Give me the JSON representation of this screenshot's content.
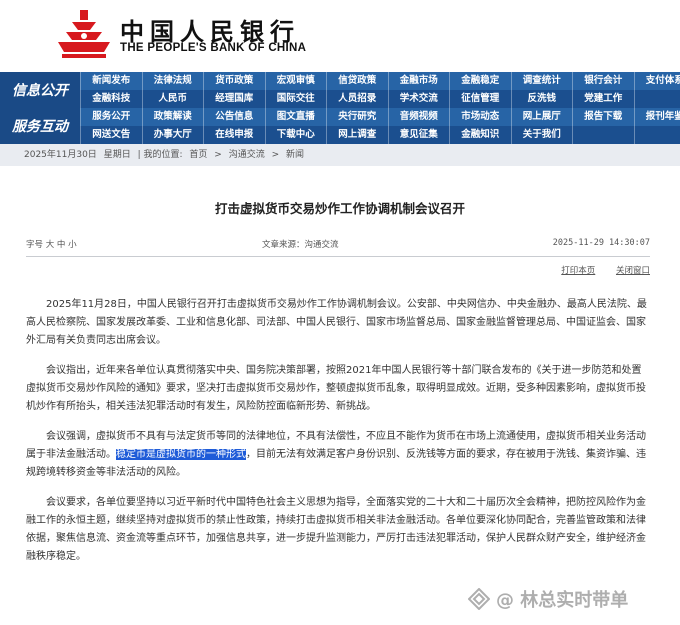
{
  "header": {
    "cn_name": "中国人民银行",
    "en_name": "THE PEOPLE'S BANK OF CHINA"
  },
  "nav": {
    "section1": "信息公开",
    "section2": "服务互动",
    "row1": [
      "新闻发布",
      "法律法规",
      "货币政策",
      "宏观审慎",
      "信贷政策",
      "金融市场",
      "金融稳定",
      "调查统计",
      "银行会计",
      "支付体系"
    ],
    "row2": [
      "金融科技",
      "人民币",
      "经理国库",
      "国际交往",
      "人员招录",
      "学术交流",
      "征信管理",
      "反洗钱",
      "党建工作",
      ""
    ],
    "row3": [
      "服务公开",
      "政策解读",
      "公告信息",
      "图文直播",
      "央行研究",
      "音频视频",
      "市场动态",
      "网上展厅",
      "报告下载",
      "报刊年鉴"
    ],
    "row4": [
      "网送文告",
      "办事大厅",
      "在线申报",
      "下载中心",
      "网上调查",
      "意见征集",
      "金融知识",
      "关于我们",
      "",
      ""
    ]
  },
  "breadcrumb": {
    "date": "2025年11月30日",
    "weekday": "星期日",
    "location_prefix": "| 我的位置:",
    "home": "首页",
    "sep": ">",
    "section": "沟通交流",
    "sub": "新闻"
  },
  "article": {
    "title": "打击虚拟货币交易炒作工作协调机制会议召开",
    "font_size_label": "字号 大 中 小",
    "source": "文章来源：沟通交流",
    "datetime": "2025-11-29  14:30:07",
    "print": "打印本页",
    "close": "关闭窗口",
    "p1": "2025年11月28日，中国人民银行召开打击虚拟货币交易炒作工作协调机制会议。公安部、中央网信办、中央金融办、最高人民法院、最高人民检察院、国家发展改革委、工业和信息化部、司法部、中国人民银行、国家市场监督总局、国家金融监督管理总局、中国证监会、国家外汇局有关负责同志出席会议。",
    "p2": "会议指出，近年来各单位认真贯彻落实中央、国务院决策部署，按照2021年中国人民银行等十部门联合发布的《关于进一步防范和处置虚拟货币交易炒作风险的通知》要求，坚决打击虚拟货币交易炒作，整顿虚拟货币乱象，取得明显成效。近期，受多种因素影响，虚拟货币投机炒作有所抬头，相关违法犯罪活动时有发生，风险防控面临新形势、新挑战。",
    "p3_before": "会议强调，虚拟货币不具有与法定货币等同的法律地位，不具有法偿性，不应且不能作为货币在市场上流通使用，虚拟货币相关业务活动属于非法金融活动。",
    "p3_highlight": "稳定币是虚拟货币的一种形式",
    "p3_after": "，目前无法有效满足客户身份识别、反洗钱等方面的要求，存在被用于洗钱、集资诈骗、违规跨境转移资金等非法活动的风险。",
    "p4": "会议要求，各单位要坚持以习近平新时代中国特色社会主义思想为指导，全面落实党的二十大和二十届历次全会精神，把防控风险作为金融工作的永恒主题，继续坚持对虚拟货币的禁止性政策，持续打击虚拟货币相关非法金融活动。各单位要深化协同配合，完善监管政策和法律依据，聚焦信息流、资金流等重点环节，加强信息共享，进一步提升监测能力，严厉打击违法犯罪活动，保护人民群众财产安全，维护经济金融秩序稳定。"
  },
  "watermark": "@ 林总实时带单",
  "colors": {
    "nav_blue": "#1b4f8f",
    "logo_red": "#d7191e",
    "highlight": "#1e5bd8"
  }
}
